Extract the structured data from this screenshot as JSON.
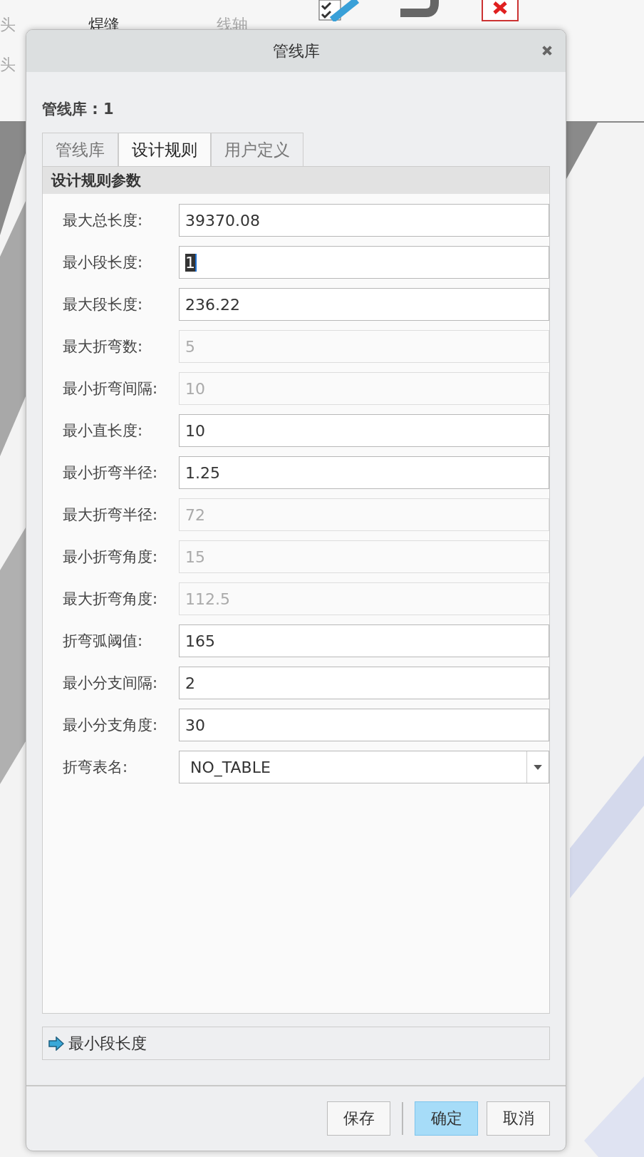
{
  "toolbar": {
    "items": [
      {
        "label": "头",
        "disabled": true
      },
      {
        "label": "头",
        "disabled": true
      },
      {
        "label": "焊缝",
        "disabled": false
      },
      {
        "label": "线轴",
        "disabled": true
      }
    ]
  },
  "dialog": {
    "title": "管线库",
    "heading": "管线库 : 1",
    "tabs": [
      {
        "label": "管线库",
        "selected": false
      },
      {
        "label": "设计规则",
        "selected": true
      },
      {
        "label": "用户定义",
        "selected": false
      }
    ],
    "section_title": "设计规则参数",
    "fields": [
      {
        "label": "最大总长度:",
        "value": "39370.08",
        "kind": "text",
        "disabled": false,
        "focused": false
      },
      {
        "label": "最小段长度:",
        "value": "1",
        "kind": "text",
        "disabled": false,
        "focused": true
      },
      {
        "label": "最大段长度:",
        "value": "236.22",
        "kind": "text",
        "disabled": false,
        "focused": false
      },
      {
        "label": "最大折弯数:",
        "value": "5",
        "kind": "text",
        "disabled": true,
        "focused": false
      },
      {
        "label": "最小折弯间隔:",
        "value": "10",
        "kind": "text",
        "disabled": true,
        "focused": false
      },
      {
        "label": "最小直长度:",
        "value": "10",
        "kind": "text",
        "disabled": false,
        "focused": false
      },
      {
        "label": "最小折弯半径:",
        "value": "1.25",
        "kind": "text",
        "disabled": false,
        "focused": false
      },
      {
        "label": "最大折弯半径:",
        "value": "72",
        "kind": "text",
        "disabled": true,
        "focused": false
      },
      {
        "label": "最小折弯角度:",
        "value": "15",
        "kind": "text",
        "disabled": true,
        "focused": false
      },
      {
        "label": "最大折弯角度:",
        "value": "112.5",
        "kind": "text",
        "disabled": true,
        "focused": false
      },
      {
        "label": "折弯弧阈值:",
        "value": "165",
        "kind": "text",
        "disabled": false,
        "focused": false
      },
      {
        "label": "最小分支间隔:",
        "value": "2",
        "kind": "text",
        "disabled": false,
        "focused": false
      },
      {
        "label": "最小分支角度:",
        "value": "30",
        "kind": "text",
        "disabled": false,
        "focused": false
      },
      {
        "label": "折弯表名:",
        "value": "NO_TABLE",
        "kind": "dropdown",
        "disabled": false,
        "focused": false
      }
    ],
    "status": "最小段长度",
    "buttons": [
      {
        "label": "保存",
        "default": false
      },
      {
        "label": "确定",
        "default": true
      },
      {
        "label": "取消",
        "default": false
      }
    ]
  }
}
